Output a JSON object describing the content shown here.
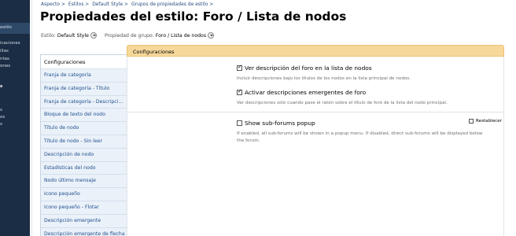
{
  "leftnav": {
    "items": [
      "estilo",
      "icaciones",
      "illas",
      "ntas",
      "ones",
      "",
      "s",
      "s",
      "os",
      "s"
    ]
  },
  "breadcrumb": [
    "Aspecto >",
    "Estilos >",
    "Default Style >",
    "Grupos de propiedades de estilo >"
  ],
  "title": "Propiedades del estilo: Foro / Lista de nodos",
  "meta": {
    "style_label": "Estilo:",
    "style_value": "Default Style",
    "group_label": "Propiedad de grupo:",
    "group_value": "Foro / Lista de nodos"
  },
  "sidebar": {
    "header": "Configuraciones",
    "items": [
      "Franja de categoría",
      "Franja de categoría - Título",
      "Franja de categoría - Descripci...",
      "Bloque de texto del nodo",
      "Título de nodo",
      "Título de nodo - Sin leer",
      "Descripción de nodo",
      "Estadísticas del nodo",
      "Nodo último mensaje",
      "Icono pequeño",
      "Icono pequeño - Flotar",
      "Descripción emergente",
      "Descripción emergente de flecha"
    ]
  },
  "panel": {
    "header": "Configuraciones",
    "options": [
      {
        "label": "Ver descripción del foro en la lista de nodos",
        "checked": true,
        "hint": "Incluir descripciones bajo los títulos de los nodos en la lista principal de nodos."
      },
      {
        "label": "Activar descripciones emergentes de foro",
        "checked": true,
        "hint": "Ver descripciones sólo cuando pase el ratón sobre el título de foro de la lista del nodo principal."
      },
      {
        "label": "Show sub-forums popup",
        "checked": false,
        "hint": "If enabled, all sub-forums will be shown in a popup menu. If disabled, direct sub-forums will be displayed below the forum."
      }
    ],
    "reset_label": "Restablecer"
  }
}
